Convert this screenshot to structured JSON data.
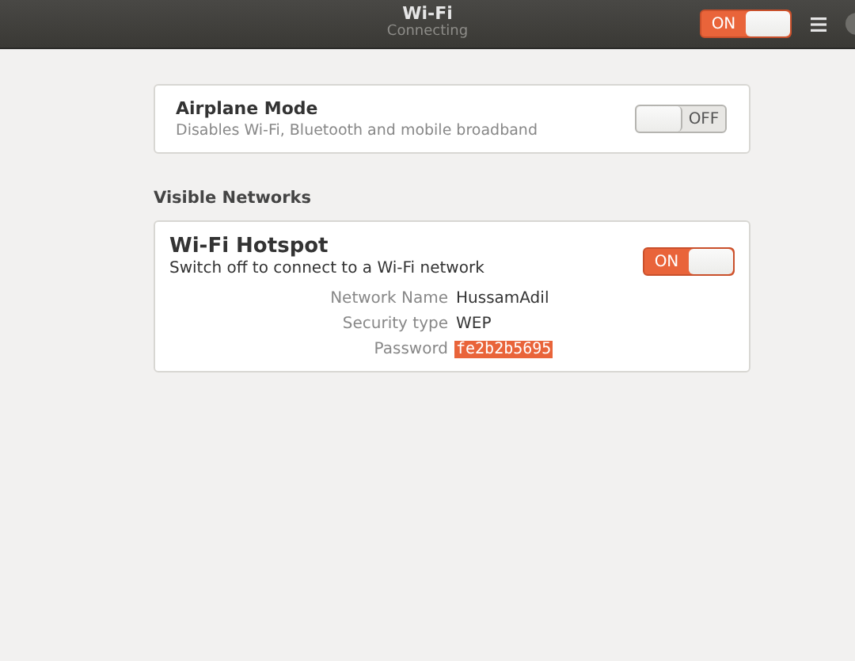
{
  "window": {
    "title": "Wi-Fi",
    "subtitle": "Connecting",
    "switch": {
      "on": true,
      "label": "ON"
    }
  },
  "airplane_mode": {
    "title": "Airplane Mode",
    "description": "Disables Wi-Fi, Bluetooth and mobile broadband",
    "switch": {
      "on": false,
      "label": "OFF"
    }
  },
  "visible_networks": {
    "heading": "Visible Networks"
  },
  "hotspot": {
    "title": "Wi-Fi Hotspot",
    "description": "Switch off to connect to a Wi-Fi network",
    "switch": {
      "on": true,
      "label": "ON"
    },
    "details": [
      {
        "label": "Network Name",
        "value": "HussamAdil",
        "selected": false
      },
      {
        "label": "Security type",
        "value": "WEP",
        "selected": false
      },
      {
        "label": "Password",
        "value": "fe2b2b5695",
        "selected": true
      }
    ]
  }
}
